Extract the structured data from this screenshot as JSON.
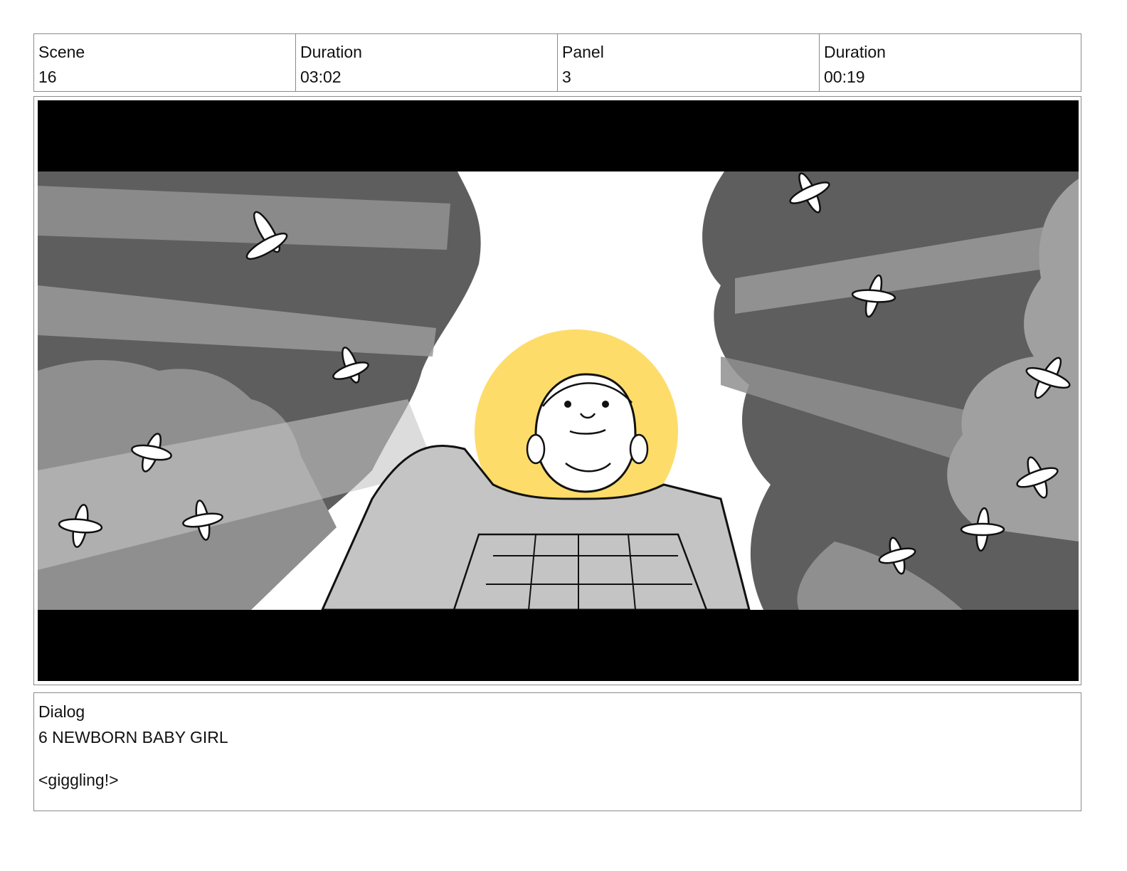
{
  "header": {
    "scene_label": "Scene",
    "scene_value": "16",
    "duration_label": "Duration",
    "duration_value": "03:02",
    "panel_label": "Panel",
    "panel_value": "3",
    "panel_duration_label": "Duration",
    "panel_duration_value": "00:19"
  },
  "dialog": {
    "label": "Dialog",
    "speaker": "6 NEWBORN BABY GIRL",
    "line": "<giggling!>"
  },
  "colors": {
    "halo": "#fddc6a",
    "letterbox": "#000000",
    "dark_foliage": "#5e5e5e",
    "mid_foliage": "#8f8f8f",
    "light_gray": "#c4c4c4"
  }
}
